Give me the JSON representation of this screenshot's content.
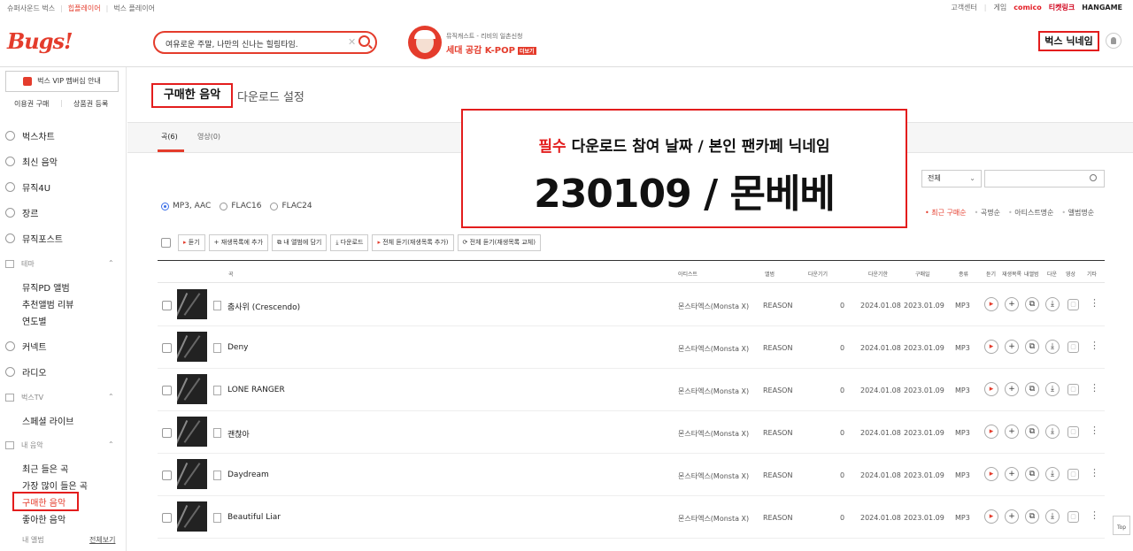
{
  "topbar": {
    "left": [
      "슈퍼사운드 벅스",
      "힙플레이어",
      "벅스 플레이어"
    ],
    "right": [
      "고객센터",
      "게임",
      "comico",
      "티켓링크",
      "HANGAME"
    ]
  },
  "logo": "Bugs!",
  "search": {
    "value": "여유로운 주말, 나만의 신나는 힐링타임."
  },
  "promo": {
    "sub": "뮤직캐스트 - 리비의 일촌신청",
    "title": "세대 공감 K-POP",
    "badge": "더보기"
  },
  "user": {
    "nickname": "벅스 닉네임"
  },
  "sidebar": {
    "vip": "벅스 VIP 멤버십 안내",
    "links": [
      "이용권 구매",
      "상품권 등록"
    ],
    "items": [
      "벅스차트",
      "최신 음악",
      "뮤직4U",
      "장르",
      "뮤직포스트"
    ],
    "theme_head": "테마",
    "theme_items": [
      "뮤직PD 앨범",
      "추천앨범 리뷰",
      "연도별"
    ],
    "items2": [
      "커넥트",
      "라디오"
    ],
    "tv_head": "벅스TV",
    "tv_items": [
      "스페셜 라이브"
    ],
    "my_head": "내 음악",
    "my_items": [
      "최근 들은 곡",
      "가장 많이 들은 곡",
      "구매한 음악",
      "좋아한 음악"
    ],
    "album_label": "내 앨범",
    "album_all": "전체보기"
  },
  "page": {
    "tab_active": "구매한 음악",
    "tab_other": "다운로드 설정"
  },
  "subtabs": {
    "songs": "곡(6)",
    "videos": "영상(0)"
  },
  "formats": [
    "MP3, AAC",
    "FLAC16",
    "FLAC24"
  ],
  "filter": {
    "select": "전체"
  },
  "sorts": [
    "최근 구매순",
    "곡명순",
    "아티스트명순",
    "앨범명순"
  ],
  "notice": {
    "prefix": "필수",
    "line1": "다운로드 참여 날짜 / 본인 팬카페 닉네임",
    "line2": "230109 / 몬베베"
  },
  "actions": [
    "듣기",
    "+ 재생목록에 추가",
    "내 앨범에 담기",
    "다운로드",
    "전체 듣기(재생목록 추가)",
    "전체 듣기(재생목록 교체)"
  ],
  "columns": [
    "곡",
    "아티스트",
    "앨범",
    "다운기기",
    "다운기한",
    "구매일",
    "종류",
    "듣기",
    "재생목록",
    "내앨범",
    "다운",
    "영상",
    "기타"
  ],
  "rows": [
    {
      "title": "춤사위 (Crescendo)",
      "artist": "몬스타엑스(Monsta X)",
      "album": "REASON",
      "count": "0",
      "expire": "2024.01.08",
      "bought": "2023.01.09",
      "type": "MP3"
    },
    {
      "title": "Deny",
      "artist": "몬스타엑스(Monsta X)",
      "album": "REASON",
      "count": "0",
      "expire": "2024.01.08",
      "bought": "2023.01.09",
      "type": "MP3"
    },
    {
      "title": "LONE RANGER",
      "artist": "몬스타엑스(Monsta X)",
      "album": "REASON",
      "count": "0",
      "expire": "2024.01.08",
      "bought": "2023.01.09",
      "type": "MP3"
    },
    {
      "title": "괜찮아",
      "artist": "몬스타엑스(Monsta X)",
      "album": "REASON",
      "count": "0",
      "expire": "2024.01.08",
      "bought": "2023.01.09",
      "type": "MP3"
    },
    {
      "title": "Daydream",
      "artist": "몬스타엑스(Monsta X)",
      "album": "REASON",
      "count": "0",
      "expire": "2024.01.08",
      "bought": "2023.01.09",
      "type": "MP3"
    },
    {
      "title": "Beautiful Liar",
      "artist": "몬스타엑스(Monsta X)",
      "album": "REASON",
      "count": "0",
      "expire": "2024.01.08",
      "bought": "2023.01.09",
      "type": "MP3"
    }
  ],
  "top_button": "Top",
  "colors": {
    "accent": "#e43c2c",
    "highlight_box": "#e31d1d"
  }
}
